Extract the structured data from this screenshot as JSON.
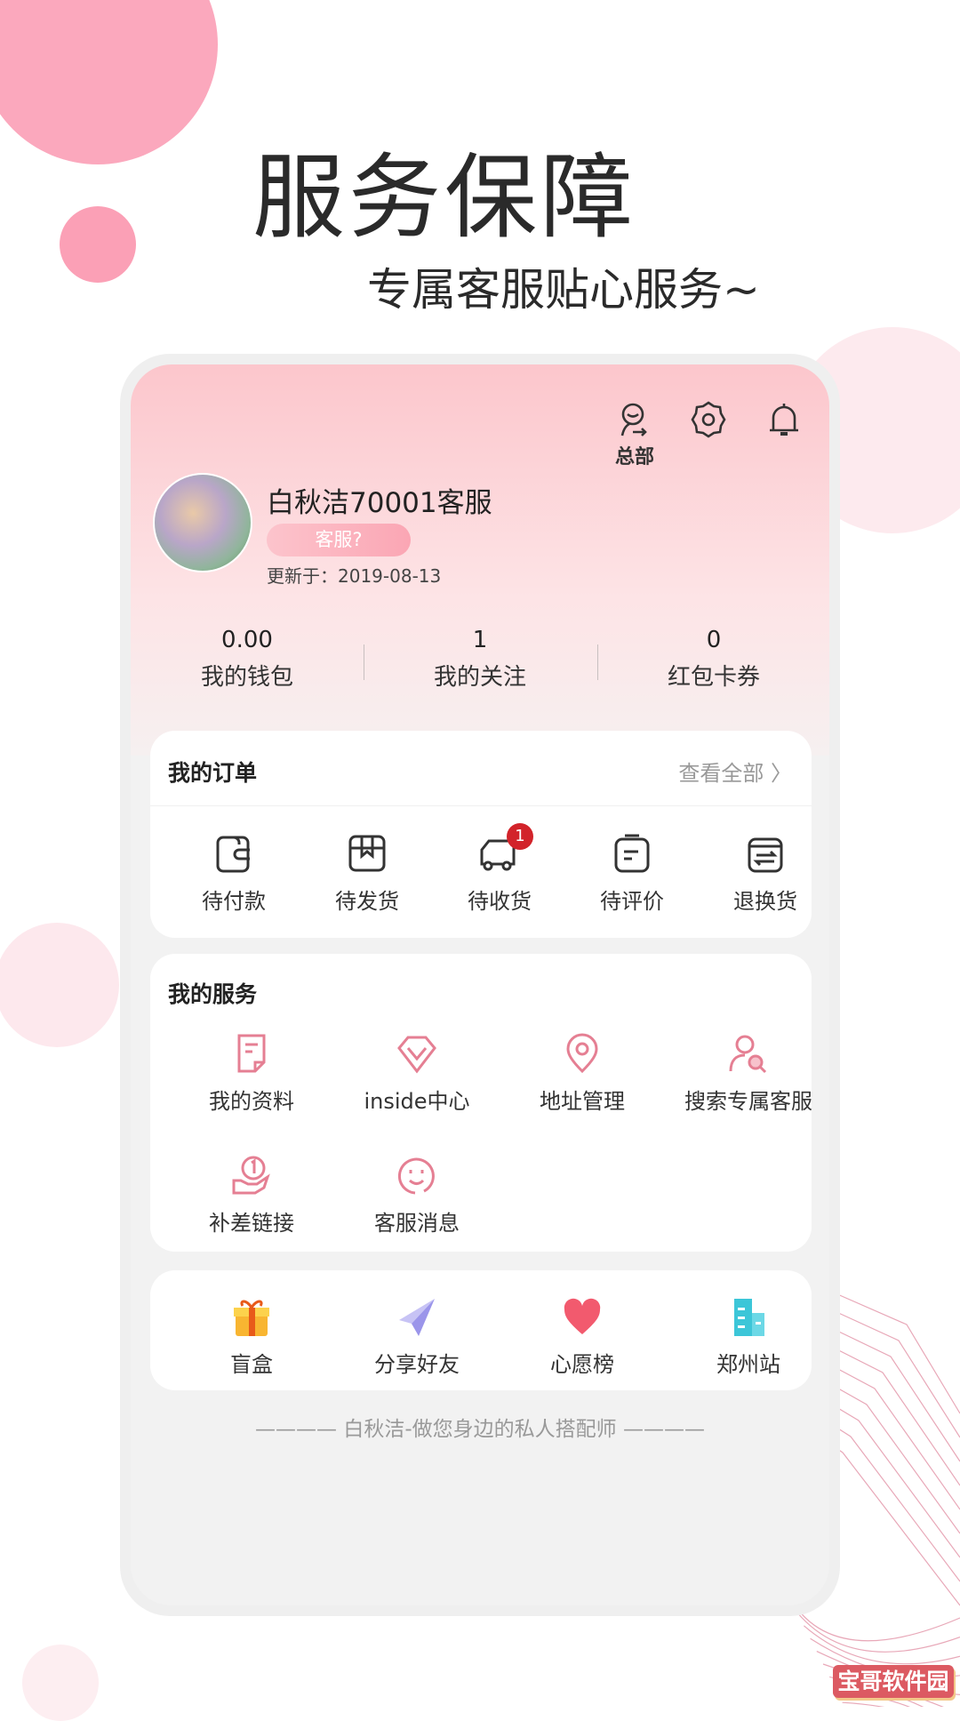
{
  "promo": {
    "title": "服务保障",
    "subtitle": "专属客服贴心服务~"
  },
  "colors": {
    "accent": "#f7a1b5",
    "header_top": "#fcc6cc",
    "badge_red": "#d2232a",
    "icon_pink": "#e57f93"
  },
  "header": {
    "icons": [
      "headset-icon",
      "gear-icon",
      "bell-icon"
    ],
    "hq_label": "总部"
  },
  "profile": {
    "name": "白秋洁70001客服",
    "badge": "客服?",
    "updated": "更新于：2019-08-13"
  },
  "stats": [
    {
      "value": "0.00",
      "label": "我的钱包"
    },
    {
      "value": "1",
      "label": "我的关注"
    },
    {
      "value": "0",
      "label": "红包卡券"
    }
  ],
  "orders": {
    "title": "我的订单",
    "view_all": "查看全部",
    "items": [
      {
        "label": "待付款",
        "icon": "wallet-icon"
      },
      {
        "label": "待发货",
        "icon": "box-icon"
      },
      {
        "label": "待收货",
        "icon": "truck-icon",
        "badge": "1"
      },
      {
        "label": "待评价",
        "icon": "clipboard-icon"
      },
      {
        "label": "退换货",
        "icon": "exchange-icon"
      }
    ]
  },
  "services": {
    "title": "我的服务",
    "items": [
      {
        "label": "我的资料",
        "icon": "document-icon"
      },
      {
        "label": "inside中心",
        "icon": "diamond-icon"
      },
      {
        "label": "地址管理",
        "icon": "location-icon"
      },
      {
        "label": "搜索专属客服",
        "icon": "user-search-icon"
      },
      {
        "label": "补差链接",
        "icon": "coin-hand-icon"
      },
      {
        "label": "客服消息",
        "icon": "smile-icon"
      }
    ]
  },
  "extras": [
    {
      "label": "盲盒",
      "icon": "gift-icon"
    },
    {
      "label": "分享好友",
      "icon": "paper-plane-icon"
    },
    {
      "label": "心愿榜",
      "icon": "heart-icon"
    },
    {
      "label": "郑州站",
      "icon": "building-icon"
    }
  ],
  "footer": "———— 白秋洁-做您身边的私人搭配师 ————",
  "watermark": "宝哥软件园"
}
